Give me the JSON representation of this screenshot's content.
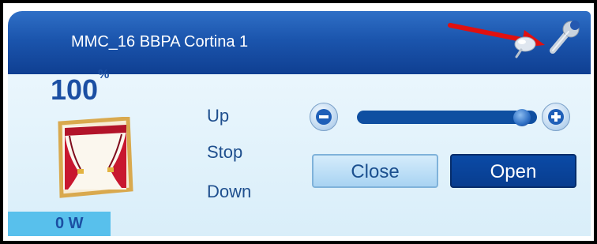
{
  "window": {
    "title": "MMC_16 BBPA Cortina 1"
  },
  "status": {
    "level": "100",
    "level_unit": "%",
    "level_fraction": 1.0,
    "power": "0 W"
  },
  "commands": {
    "up": "Up",
    "stop": "Stop",
    "down": "Down"
  },
  "slider": {
    "value_fraction": 0.96
  },
  "buttons": {
    "close": "Close",
    "open": "Open"
  },
  "colors": {
    "title_bar": "#1b55ad",
    "body_bg": "#e1f2fb",
    "accent": "#0f4fa1",
    "power_strip": "#58c0ec",
    "annotation_arrow": "#e01010"
  },
  "icons": {
    "device": "curtain-icon",
    "pin": "pin-icon",
    "settings": "wrench-icon",
    "decrease": "minus-icon",
    "increase": "plus-icon"
  }
}
